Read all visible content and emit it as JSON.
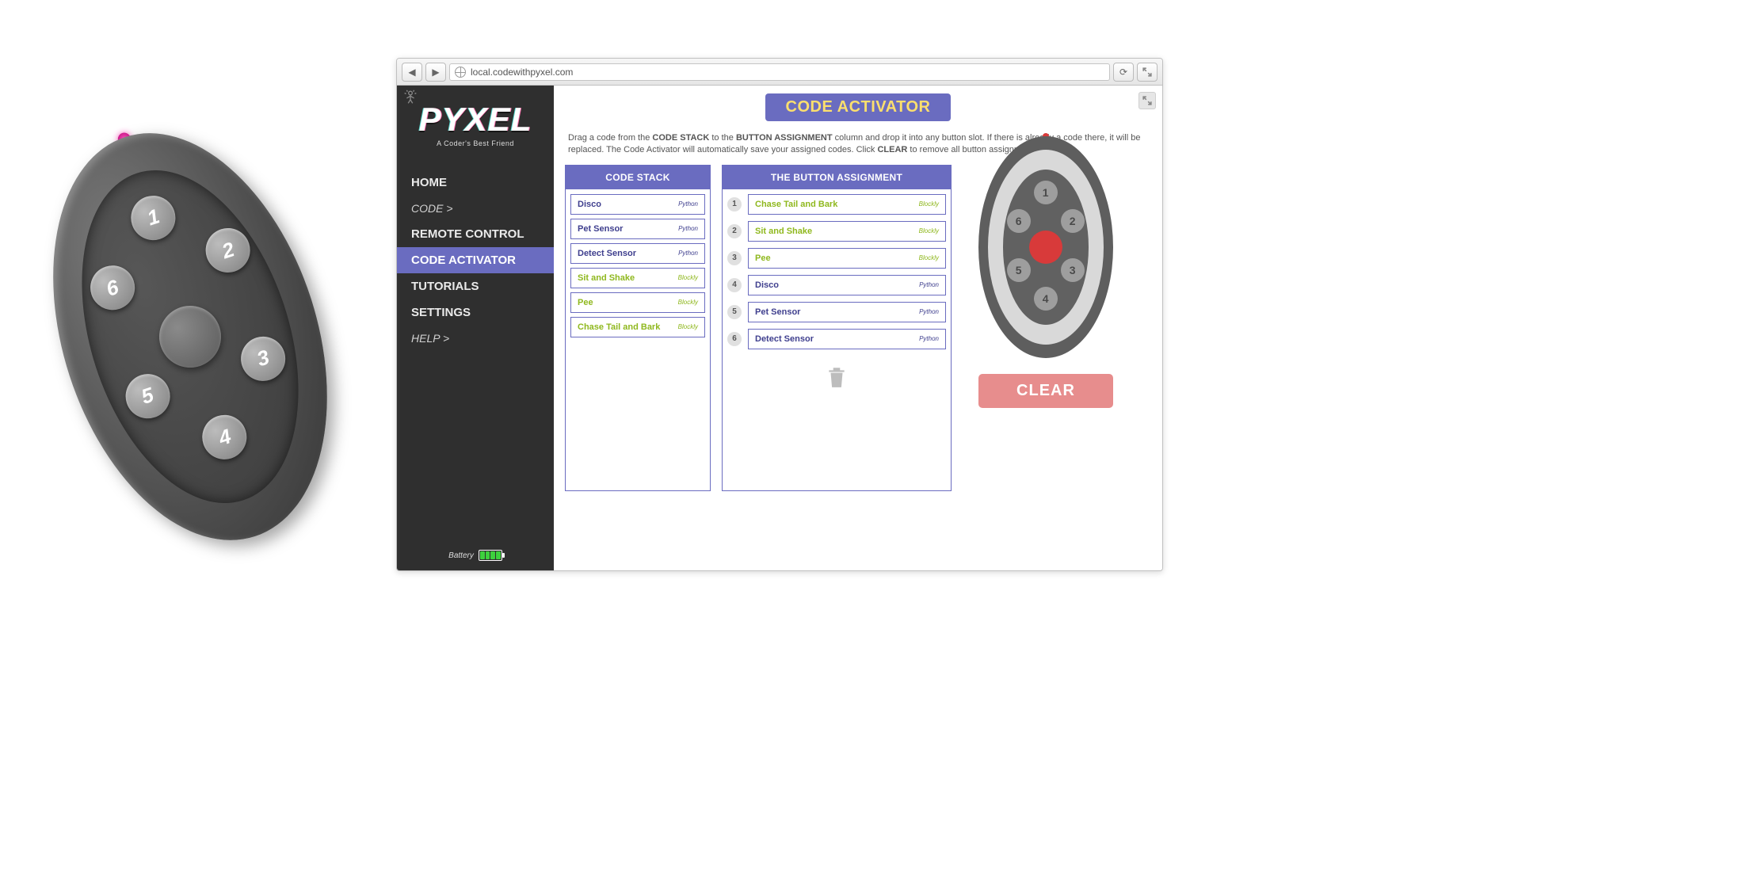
{
  "browser": {
    "url": "local.codewithpyxel.com"
  },
  "logo": {
    "text": "PYXEL",
    "sub": "A Coder's Best Friend"
  },
  "nav": {
    "home": "HOME",
    "code": "CODE >",
    "remote": "REMOTE CONTROL",
    "activator": "CODE ACTIVATOR",
    "tutorials": "TUTORIALS",
    "settings": "SETTINGS",
    "help": "HELP >"
  },
  "battery": {
    "label": "Battery"
  },
  "page": {
    "title": "CODE ACTIVATOR",
    "instructions_pre": "Drag a code from the ",
    "instr_b1": "CODE STACK",
    "instr_mid1": " to the ",
    "instr_b2": "BUTTON ASSIGNMENT",
    "instr_mid2": " column and drop it into any button slot. If there is already a code there, it will be replaced. The Code Activator will automatically save your assigned codes. Click ",
    "instr_b3": "CLEAR",
    "instr_end": " to remove all button assignments."
  },
  "headers": {
    "stack": "CODE STACK",
    "assign": "THE BUTTON ASSIGNMENT"
  },
  "stack": [
    {
      "name": "Disco",
      "lang": "Python",
      "cls": "python"
    },
    {
      "name": "Pet Sensor",
      "lang": "Python",
      "cls": "python"
    },
    {
      "name": "Detect Sensor",
      "lang": "Python",
      "cls": "python"
    },
    {
      "name": "Sit and Shake",
      "lang": "Blockly",
      "cls": "blockly"
    },
    {
      "name": "Pee",
      "lang": "Blockly",
      "cls": "blockly"
    },
    {
      "name": "Chase Tail and Bark",
      "lang": "Blockly",
      "cls": "blockly"
    }
  ],
  "assignments": [
    {
      "num": "1",
      "name": "Chase Tail and Bark",
      "lang": "Blockly",
      "cls": "blockly"
    },
    {
      "num": "2",
      "name": "Sit and Shake",
      "lang": "Blockly",
      "cls": "blockly"
    },
    {
      "num": "3",
      "name": "Pee",
      "lang": "Blockly",
      "cls": "blockly"
    },
    {
      "num": "4",
      "name": "Disco",
      "lang": "Python",
      "cls": "python"
    },
    {
      "num": "5",
      "name": "Pet Sensor",
      "lang": "Python",
      "cls": "python"
    },
    {
      "num": "6",
      "name": "Detect Sensor",
      "lang": "Python",
      "cls": "python"
    }
  ],
  "remote_buttons": [
    "1",
    "2",
    "3",
    "4",
    "5",
    "6"
  ],
  "clear": "CLEAR"
}
